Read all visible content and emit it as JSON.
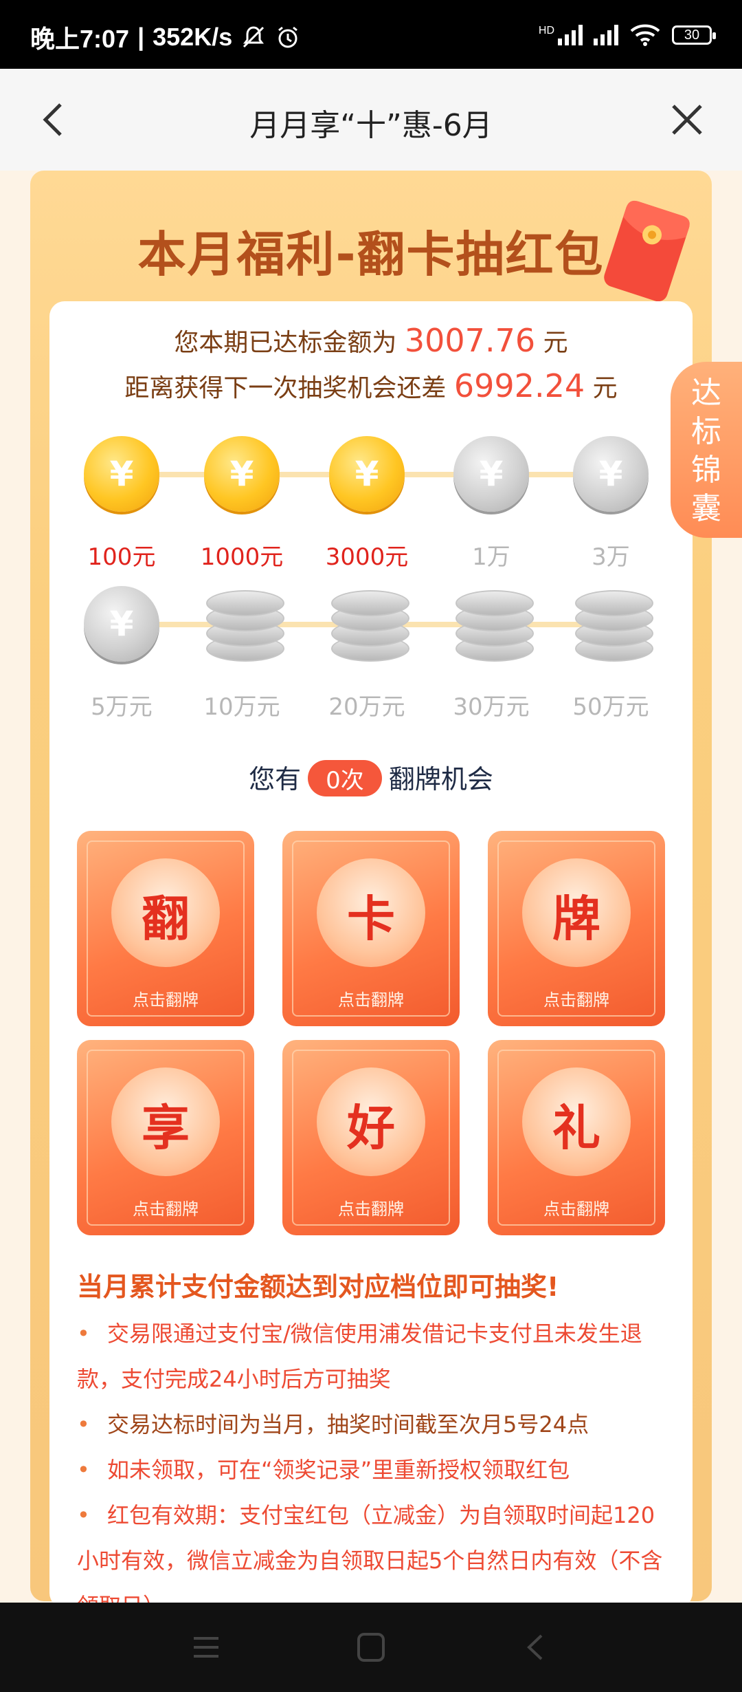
{
  "status_bar": {
    "time": "晚上7:07",
    "separator": "|",
    "speed": "352K/s",
    "hd": "HD",
    "battery": "30"
  },
  "nav": {
    "title": "月月享“十”惠-6月"
  },
  "banner": {
    "title": "本月福利-翻卡抽红包"
  },
  "progress": {
    "line1_prefix": "您本期已达标金额为",
    "line1_amount": "3007.76",
    "line1_unit": "元",
    "line2_prefix": "距离获得下一次抽奖机会还差",
    "line2_amount": "6992.24",
    "line2_unit": "元"
  },
  "tiers": [
    {
      "label": "100元",
      "reached": true
    },
    {
      "label": "1000元",
      "reached": true
    },
    {
      "label": "3000元",
      "reached": true
    },
    {
      "label": "1万",
      "reached": false
    },
    {
      "label": "3万",
      "reached": false
    },
    {
      "label": "5万元",
      "reached": false
    },
    {
      "label": "10万元",
      "reached": false
    },
    {
      "label": "20万元",
      "reached": false
    },
    {
      "label": "30万元",
      "reached": false
    },
    {
      "label": "50万元",
      "reached": false
    }
  ],
  "chance": {
    "prefix": "您有",
    "count": "0次",
    "suffix": "翻牌机会"
  },
  "cards": [
    {
      "char": "翻",
      "hint": "点击翻牌"
    },
    {
      "char": "卡",
      "hint": "点击翻牌"
    },
    {
      "char": "牌",
      "hint": "点击翻牌"
    },
    {
      "char": "享",
      "hint": "点击翻牌"
    },
    {
      "char": "好",
      "hint": "点击翻牌"
    },
    {
      "char": "礼",
      "hint": "点击翻牌"
    }
  ],
  "rules": {
    "title": "当月累计支付金额达到对应档位即可抽奖!",
    "bullet": "•",
    "items": [
      "交易限通过支付宝/微信使用浦发借记卡支付且未发生退款，支付完成24小时后方可抽奖",
      "交易达标时间为当月，抽奖时间截至次月5号24点",
      "如未领取，可在“领奖记录”里重新授权领取红包",
      "红包有效期：支付宝红包（立减金）为自领取时间起120小时有效，微信立减金为自领取日起5个自然日内有效（不含领取日）"
    ]
  },
  "side_tab": {
    "chars": [
      "达",
      "标",
      "锦",
      "囊"
    ]
  },
  "colors": {
    "accent": "#f5573b",
    "frame": "#fbcf7f",
    "rule_red": "#ed4a33",
    "rule_brown": "#a0461a"
  },
  "icons": [
    "back-arrow-icon",
    "close-icon",
    "yen-coin-icon",
    "coin-stack-icon",
    "red-envelope-icon",
    "menu-icon",
    "home-icon",
    "nav-back-icon"
  ]
}
